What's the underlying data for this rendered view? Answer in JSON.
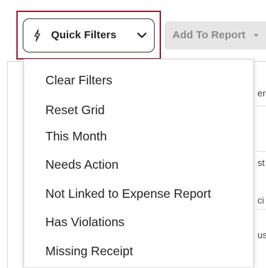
{
  "toolbar": {
    "quick_filters_label": "Quick Filters",
    "add_to_report_label": "Add To Report"
  },
  "quick_filters_menu": {
    "items": [
      {
        "label": "Clear Filters"
      },
      {
        "label": "Reset Grid"
      },
      {
        "label": "This Month"
      },
      {
        "label": "Needs Action"
      },
      {
        "label": "Not Linked to Expense Report"
      },
      {
        "label": "Has Violations"
      },
      {
        "label": "Missing Receipt"
      }
    ]
  },
  "grid_partial": {
    "fragments": [
      "erc",
      "st",
      "ci",
      "us"
    ]
  },
  "colors": {
    "highlight_border": "#9d2235",
    "disabled_button_bg": "#e6e6e6"
  }
}
